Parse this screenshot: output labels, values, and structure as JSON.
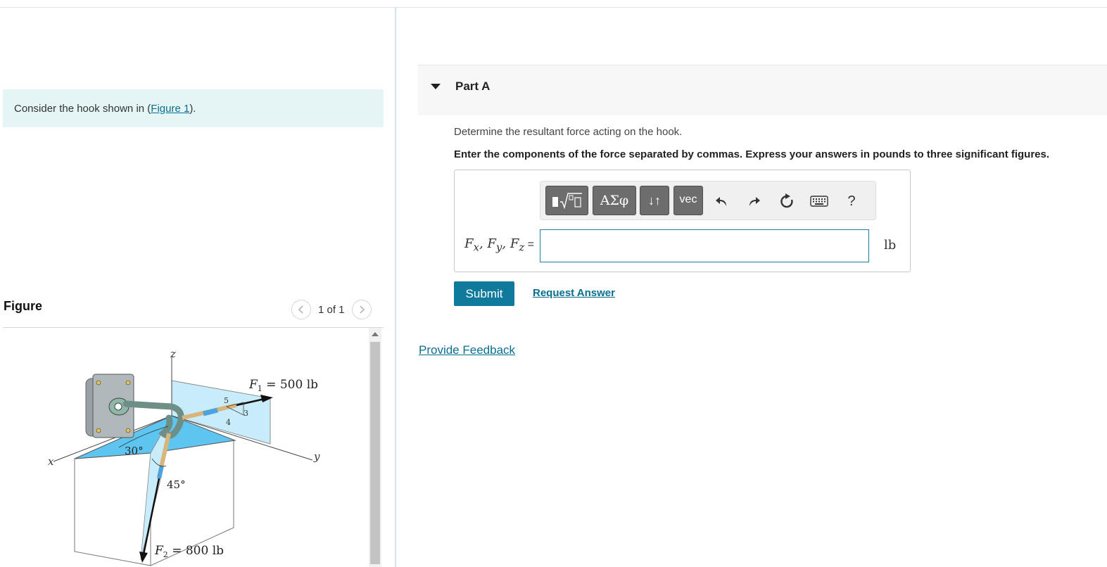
{
  "intro": {
    "text_before": "Consider the hook shown in (",
    "link": "Figure 1",
    "text_after": ")."
  },
  "figure_panel": {
    "title": "Figure",
    "pager": "1 of 1",
    "prev_icon": "chevron-left-icon",
    "next_icon": "chevron-right-icon",
    "labels": {
      "z": "z",
      "x": "x",
      "y": "y",
      "f1_symbol": "F",
      "f1_sub": "1",
      "f1_value": " = 500 lb",
      "f2_symbol": "F",
      "f2_sub": "2",
      "f2_value": " = 800 lb",
      "angle1": "30°",
      "angle2": "45°",
      "tri_5": "5",
      "tri_4": "4",
      "tri_3": "3"
    }
  },
  "part": {
    "title": "Part A",
    "question": "Determine the resultant force acting on the hook.",
    "instruction": "Enter the components of the force separated by commas. Express your answers in pounds to three significant figures."
  },
  "toolbar": {
    "templates_icon": "fraction-sqrt-template-icon",
    "greek_label": "ΑΣφ",
    "arrows_label": "↓↑",
    "vec_label": "vec",
    "icons": [
      "undo-icon",
      "redo-icon",
      "reset-icon",
      "keyboard-icon"
    ],
    "help_label": "?"
  },
  "answer": {
    "label_parts": [
      "F",
      "x",
      ", F",
      "y",
      ", F",
      "z"
    ],
    "equals": " =",
    "value": "",
    "unit": "lb"
  },
  "actions": {
    "submit_label": "Submit",
    "request_label": "Request Answer",
    "feedback_label": "Provide Feedback"
  },
  "colors": {
    "accent": "#0f7a9c",
    "link": "#0a6e8f",
    "intro_bg": "#e5f5f5"
  }
}
